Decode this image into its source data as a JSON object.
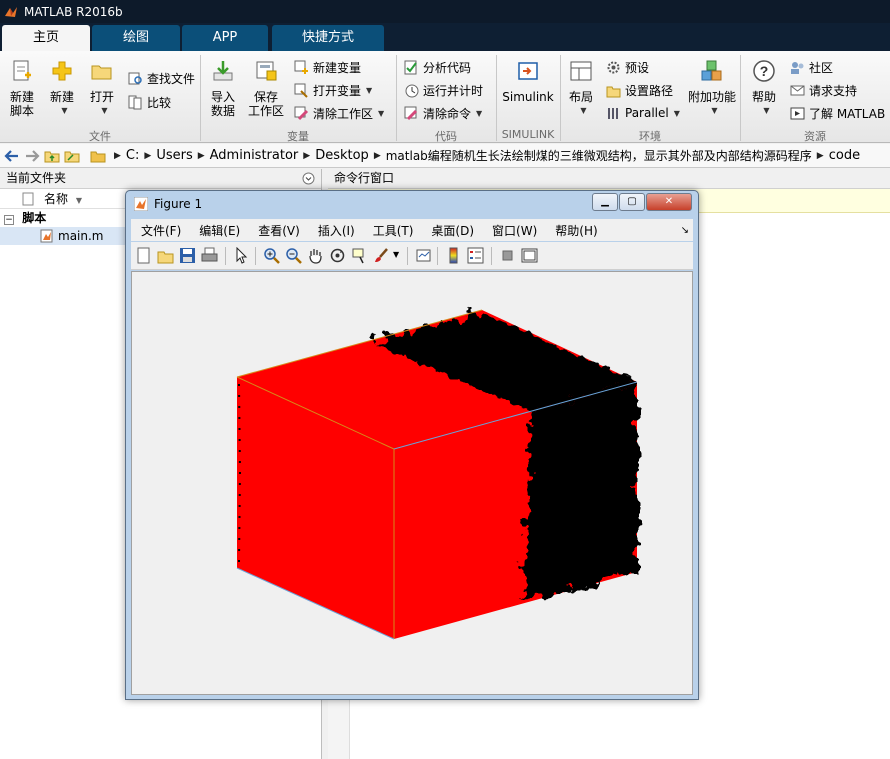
{
  "app": {
    "title": "MATLAB R2016b"
  },
  "tabs": [
    {
      "label": "主页",
      "active": true
    },
    {
      "label": "绘图",
      "active": false
    },
    {
      "label": "APP",
      "active": false
    },
    {
      "label": "快捷方式",
      "active": false
    }
  ],
  "ribbon": {
    "file": {
      "group": "文件",
      "new_script_line1": "新建",
      "new_script_line2": "脚本",
      "new": "新建",
      "open": "打开",
      "find_files": "查找文件",
      "compare": "比较"
    },
    "variable": {
      "group": "变量",
      "import_line1": "导入",
      "import_line2": "数据",
      "save_line1": "保存",
      "save_line2": "工作区",
      "new_var": "新建变量",
      "open_var": "打开变量",
      "clear_ws": "清除工作区"
    },
    "code": {
      "group": "代码",
      "analyze": "分析代码",
      "run_time": "运行并计时",
      "clear_cmd": "清除命令"
    },
    "simulink": {
      "group": "SIMULINK",
      "label": "Simulink"
    },
    "env": {
      "group": "环境",
      "layout": "布局",
      "prefs": "预设",
      "set_path": "设置路径",
      "parallel": "Parallel",
      "addons": "附加功能"
    },
    "resources": {
      "group": "资源",
      "help": "帮助",
      "community": "社区",
      "support": "请求支持",
      "learn": "了解 MATLAB"
    }
  },
  "address": {
    "crumbs": [
      "C:",
      "Users",
      "Administrator",
      "Desktop",
      "matlab编程随机生长法绘制煤的三维微观结构，显示其外部及内部结构源码程序",
      "code"
    ]
  },
  "left_panel": {
    "title": "当前文件夹",
    "col_name": "名称",
    "folder": "脚本",
    "file": "main.m"
  },
  "command_window": {
    "title": "命令行窗口"
  },
  "figure": {
    "title": "Figure 1",
    "menus": [
      "文件(F)",
      "编辑(E)",
      "查看(V)",
      "插入(I)",
      "工具(T)",
      "桌面(D)",
      "窗口(W)",
      "帮助(H)"
    ]
  },
  "colors": {
    "cube_red": "#ff0000",
    "cube_black": "#000000",
    "accent": "#0b4f79"
  }
}
